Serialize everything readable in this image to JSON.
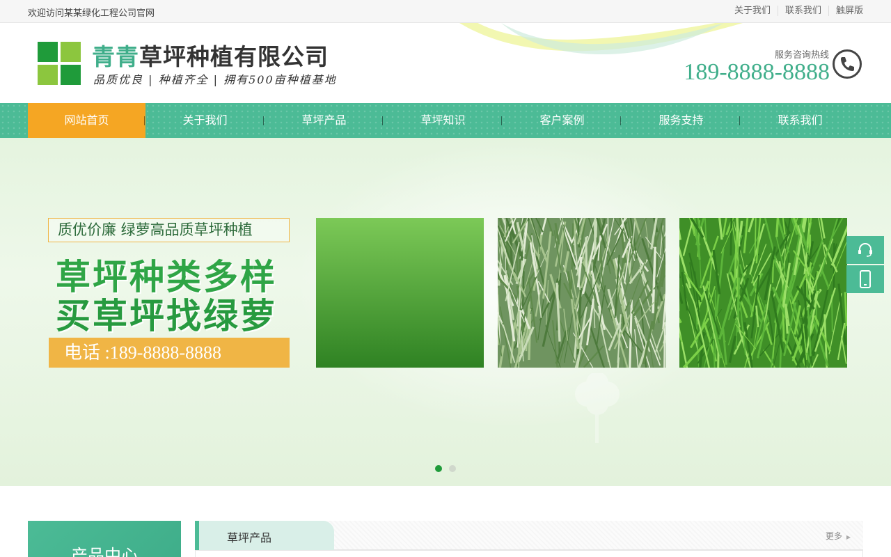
{
  "topbar": {
    "welcome": "欢迎访问某某绿化工程公司官网",
    "links": [
      "关于我们",
      "联系我们",
      "触屏版"
    ]
  },
  "header": {
    "company_accent": "青青",
    "company_rest": "草坪种植有限公司",
    "slogan": "品质优良 | 种植齐全 | 拥有500亩种植基地",
    "hotline_label": "服务咨询热线",
    "hotline_number": "189-8888-8888"
  },
  "nav": {
    "items": [
      "网站首页",
      "关于我们",
      "草坪产品",
      "草坪知识",
      "客户案例",
      "服务支持",
      "联系我们"
    ],
    "active_index": 0
  },
  "banner": {
    "tagline": "质优价廉  绿萝高品质草坪种植",
    "headline1": "草坪种类多样",
    "headline2": "买草坪找绿萝",
    "phone": "电话 :189-8888-8888",
    "slide_count": 2,
    "active_slide": 0
  },
  "side_buttons": [
    "headset-icon",
    "mobile-icon"
  ],
  "product_center": {
    "title": "产品中心"
  },
  "products_section": {
    "tab": "草坪产品",
    "more": "更多"
  },
  "colors": {
    "brand": "#4cbb96",
    "active_nav": "#f5a623",
    "dark_green": "#1f9b3a"
  }
}
